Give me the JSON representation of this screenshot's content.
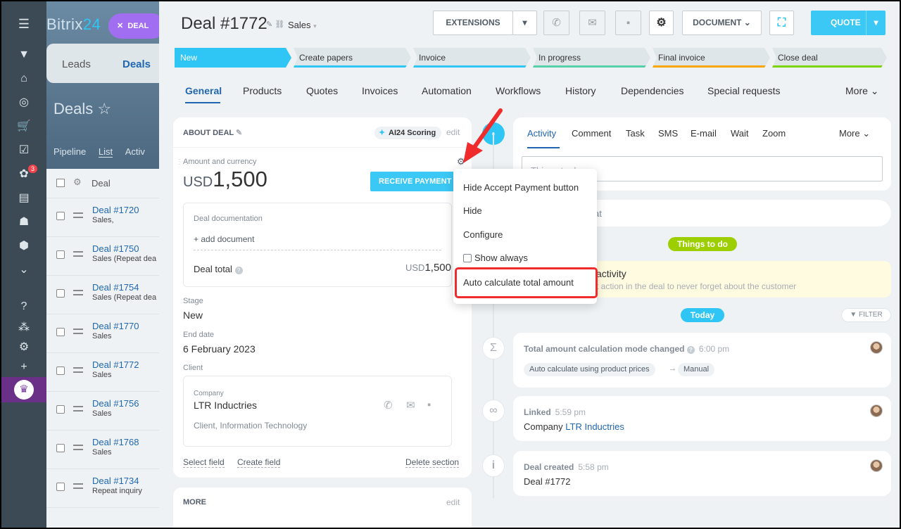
{
  "app": {
    "logo_main": "Bitrix",
    "logo_num": "24",
    "deal_pill": "DEAL",
    "badge": "3"
  },
  "bg": {
    "tabs": [
      "Leads",
      "Deals"
    ],
    "title": "Deals",
    "subnav": [
      "Pipeline",
      "List",
      "Activ"
    ],
    "list_header": "Deal",
    "rows": [
      {
        "name": "Deal #1720",
        "sub": "Sales,"
      },
      {
        "name": "Deal #1750",
        "sub": "Sales (Repeat dea"
      },
      {
        "name": "Deal #1754",
        "sub": "Sales (Repeat dea"
      },
      {
        "name": "Deal #1770",
        "sub": "Sales"
      },
      {
        "name": "Deal #1772",
        "sub": "Sales"
      },
      {
        "name": "Deal #1756",
        "sub": "Sales"
      },
      {
        "name": "Deal #1768",
        "sub": "Sales"
      },
      {
        "name": "Deal #1734",
        "sub": "Repeat inquiry"
      }
    ]
  },
  "header": {
    "title": "Deal #1772",
    "category": "Sales",
    "extensions": "EXTENSIONS",
    "document": "DOCUMENT",
    "quote": "QUOTE"
  },
  "stages": [
    {
      "label": "New",
      "color": "#2fc6f6"
    },
    {
      "label": "Create papers",
      "color": "#2fc6f6"
    },
    {
      "label": "Invoice",
      "color": "#2fc6f6"
    },
    {
      "label": "In progress",
      "color": "#55d0a8"
    },
    {
      "label": "Final invoice",
      "color": "#f7a700"
    },
    {
      "label": "Close deal",
      "color": "#7bd500"
    }
  ],
  "tabs": [
    "General",
    "Products",
    "Quotes",
    "Invoices",
    "Automation",
    "Workflows",
    "History",
    "Dependencies",
    "Special requests",
    "More"
  ],
  "about": {
    "title": "ABOUT DEAL",
    "ai_scoring": "AI24 Scoring",
    "edit": "edit",
    "amount_label": "Amount and currency",
    "currency": "USD",
    "amount": "1,500",
    "receive_payment": "RECEIVE PAYMENT",
    "doc_label": "Deal documentation",
    "add_document": "+ add document",
    "deal_total_label": "Deal total",
    "deal_total_currency": "USD",
    "deal_total_value": "1,500",
    "stage_label": "Stage",
    "stage_value": "New",
    "end_date_label": "End date",
    "end_date_value": "6 February 2023",
    "client_label": "Client",
    "company_label": "Company",
    "company_name": "LTR Inductries",
    "company_type": "Client, Information Technology",
    "select_field": "Select field",
    "create_field": "Create field",
    "delete_section": "Delete section"
  },
  "more_section": {
    "title": "MORE",
    "edit": "edit"
  },
  "menu": {
    "items": [
      "Hide Accept Payment button",
      "Hide",
      "Configure",
      "Show always",
      "Auto calculate total amount"
    ]
  },
  "activity": {
    "tabs": [
      "Activity",
      "Comment",
      "Task",
      "SMS",
      "E-mail",
      "Wait",
      "Zoom",
      "More"
    ],
    "placeholder": "Things to do",
    "row2_tail": "at",
    "things_to_do": "Things to do",
    "todo_title": "activity",
    "todo_sub": "t action in the deal to never forget about the customer",
    "today": "Today",
    "filter": "FILTER"
  },
  "feed": [
    {
      "title": "Total amount calculation mode changed",
      "time": "6:00 pm",
      "chip_from": "Auto calculate using product prices",
      "chip_to": "Manual"
    },
    {
      "title": "Linked",
      "time": "5:59 pm",
      "prefix": "Company",
      "link": "LTR Inductries"
    },
    {
      "title": "Deal created",
      "time": "5:58 pm",
      "body": "Deal #1772"
    }
  ]
}
